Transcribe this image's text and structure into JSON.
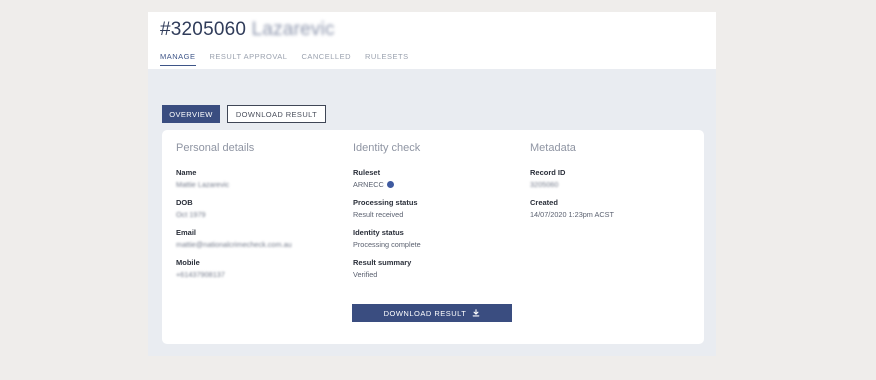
{
  "header": {
    "title_prefix": "#3205060",
    "title_name": "Lazarevic",
    "tabs": [
      "MANAGE",
      "RESULT APPROVAL",
      "CANCELLED",
      "RULESETS"
    ]
  },
  "subnav": {
    "overview_label": "OVERVIEW",
    "download_label": "DOWNLOAD RESULT"
  },
  "personal": {
    "heading": "Personal details",
    "fields": [
      {
        "label": "Name",
        "value": "Mattie Lazarevic"
      },
      {
        "label": "DOB",
        "value": "Oct 1979"
      },
      {
        "label": "Email",
        "value": "mattie@nationalcrimecheck.com.au"
      },
      {
        "label": "Mobile",
        "value": "+61437908137"
      }
    ]
  },
  "identity": {
    "heading": "Identity check",
    "fields": [
      {
        "label": "Ruleset",
        "value": "ARNECC"
      },
      {
        "label": "Processing status",
        "value": "Result received"
      },
      {
        "label": "Identity status",
        "value": "Processing complete"
      },
      {
        "label": "Result summary",
        "value": "Verified"
      }
    ]
  },
  "metadata": {
    "heading": "Metadata",
    "fields": [
      {
        "label": "Record ID",
        "value": "3205060"
      },
      {
        "label": "Created",
        "value": "14/07/2020 1:23pm ACST"
      }
    ]
  },
  "download_button": {
    "label": "DOWNLOAD RESULT"
  },
  "icons": {
    "info": "info-icon",
    "download": "download-icon"
  },
  "colors": {
    "accent": "#3a4d80",
    "page_bg": "#efedeb",
    "panel_bg": "#e9ecf1"
  }
}
